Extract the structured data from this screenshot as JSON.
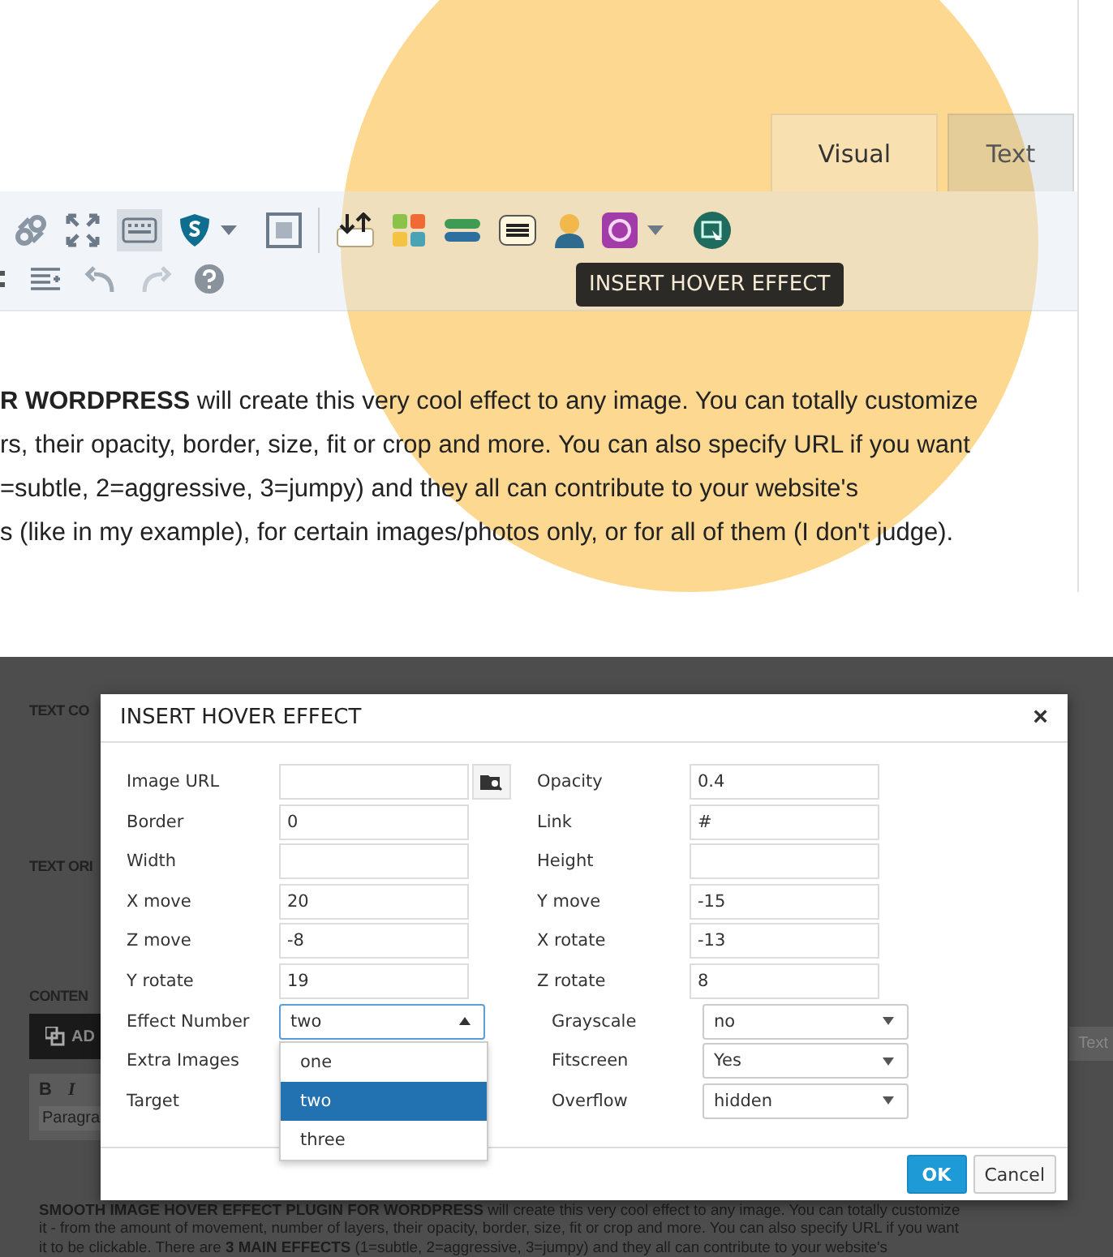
{
  "editor": {
    "tabs": [
      {
        "label": "Visual",
        "selected": true
      },
      {
        "label": "Text",
        "selected": false
      }
    ],
    "tooltip": "INSERT HOVER EFFECT",
    "paragraph": [
      "**R WORDPRESS** will create this very cool effect to any image. You can totally customize",
      "rs, their opacity, border, size, fit or crop and more. You can also specify URL if you want",
      "=subtle, 2=aggressive, 3=jumpy) and they all can contribute to your website's",
      "s (like in my example),  for certain images/photos only, or for all of them (I don't judge)."
    ]
  },
  "background": {
    "labels": [
      "TEXT CO",
      "TEXT ORI",
      "CONTEN"
    ],
    "add_button": "AD",
    "format_buttons": [
      "B",
      "I"
    ],
    "format_select": "Paragra",
    "text_tab": "Text",
    "paragraph": [
      "**SMOOTH IMAGE HOVER EFFECT PLUGIN FOR WORDPRESS** will create this very cool effect to any image. You can totally customize",
      "it - from the amount of movement, number of layers, their opacity, border, size, fit or crop and more. You can also specify URL if you want",
      "it to be clickable. There are **3 MAIN EFFECTS** (1=subtle, 2=aggressive, 3=jumpy) and they all can contribute to your website's"
    ]
  },
  "modal": {
    "title": "INSERT HOVER EFFECT",
    "close": "×",
    "rows": [
      {
        "left": {
          "label": "Image URL",
          "kind": "file"
        },
        "right": {
          "label": "Opacity",
          "kind": "text",
          "value": "0.4"
        }
      },
      {
        "left": {
          "label": "Border",
          "kind": "text",
          "value": "0"
        },
        "right": {
          "label": "Link",
          "kind": "text",
          "value": "#"
        }
      },
      {
        "left": {
          "label": "Width",
          "kind": "text"
        },
        "right": {
          "label": "Height",
          "kind": "text"
        }
      },
      {
        "left": {
          "label": "X move",
          "kind": "text",
          "value": "20"
        },
        "right": {
          "label": "Y move",
          "kind": "text",
          "value": "-15"
        }
      },
      {
        "left": {
          "label": "Z move",
          "kind": "text",
          "value": "-8"
        },
        "right": {
          "label": "X rotate",
          "kind": "text",
          "value": "-13"
        }
      },
      {
        "left": {
          "label": "Y rotate",
          "kind": "text",
          "value": "19"
        },
        "right": {
          "label": "Z rotate",
          "kind": "text",
          "value": "8"
        }
      },
      {
        "left": {
          "label": "Effect Number",
          "kind": "select",
          "value": "two",
          "expanded": true,
          "options": [
            {
              "label": "one",
              "selected": false
            },
            {
              "label": "two",
              "selected": true
            },
            {
              "label": "three",
              "selected": false
            }
          ]
        },
        "right": {
          "label": "Grayscale",
          "kind": "select",
          "value": "no",
          "expanded": false
        }
      },
      {
        "left": {
          "label": "Extra Images",
          "kind": "label"
        },
        "right": {
          "label": "Fitscreen",
          "kind": "select",
          "value": "Yes",
          "expanded": false
        }
      },
      {
        "left": {
          "label": "Target",
          "kind": "label"
        },
        "right": {
          "label": "Overflow",
          "kind": "select",
          "value": "hidden",
          "expanded": false
        }
      }
    ],
    "buttons": [
      {
        "label": "OK",
        "kind": "primary"
      },
      {
        "label": "Cancel",
        "kind": "secondary"
      }
    ]
  }
}
